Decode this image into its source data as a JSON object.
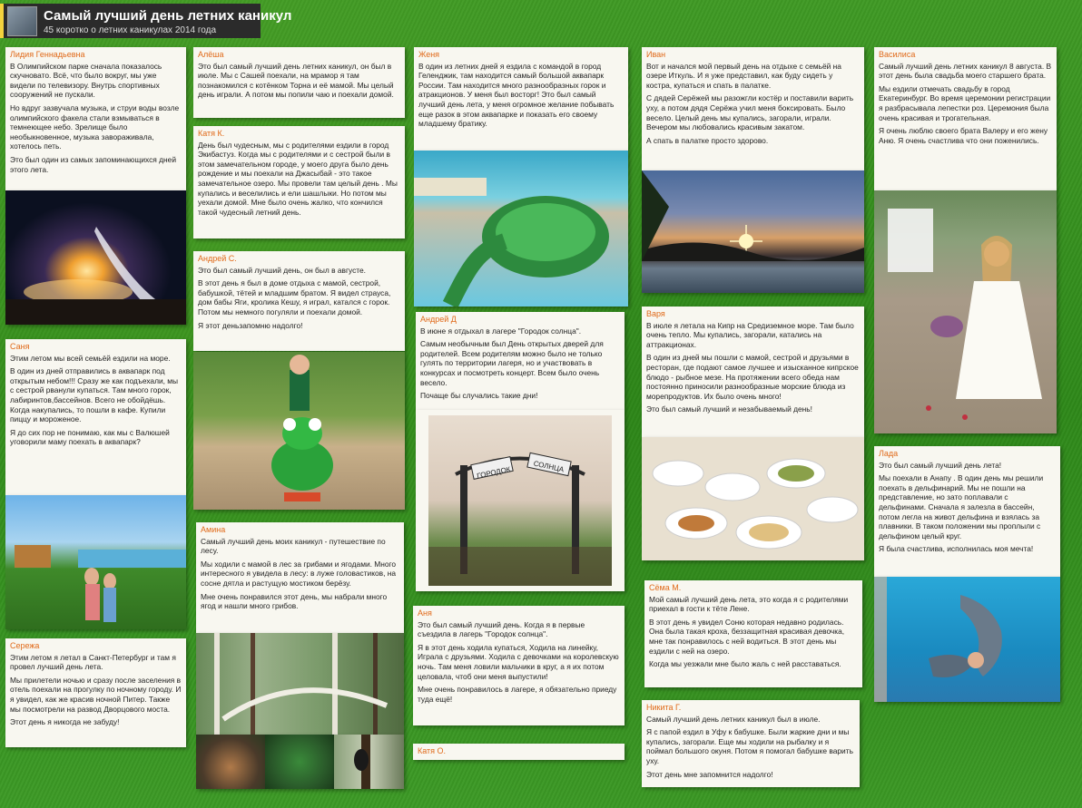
{
  "header": {
    "title": "Самый лучший день летних каникул",
    "subtitle": "45 коротко о летних каникулах 2014 года"
  },
  "notes": {
    "lidiya": {
      "author": "Лидия Геннадьевна",
      "p": [
        "В Олимпийском парке сначала показалось скучновато. Всё, что было вокруг, мы уже видели по телевизору. Внутрь спортивных сооружений не пускали.",
        "Но вдруг зазвучала музыка, и струи воды возле олимпийского факела стали взмываться в темнеющее небо. Зрелище было необыкновенное, музыка завораживала, хотелось петь.",
        "Это был один из самых запоминающихся дней этого лета."
      ]
    },
    "sanya": {
      "author": "Саня",
      "p": [
        "Этим летом мы всей семьёй ездили на море.",
        "В один из дней отправились в аквапарк под открытым небом!!! Сразу же как подъехали, мы с сестрой рванули купаться. Там много горок, лабиринтов,бассейнов. Всего не обойдёшь. Когда накупались, то пошли в кафе. Купили пиццу и мороженое.",
        "Я до сих пор не понимаю, как мы с Валюшей уговорили маму поехать в аквапарк?"
      ]
    },
    "serezha": {
      "author": "Сережа",
      "p": [
        "Этим летом я летал в Санкт-Петербург и там я провел лучший день лета.",
        "Мы прилетели ночью и сразу после заселения в отель поехали на прогулку по ночному городу. И я увидел, как же красив ночной Питер. Также мы посмотрели на развод Дворцового моста.",
        "Этот день я никогда не забуду!"
      ]
    },
    "alyosha": {
      "author": "Алёша",
      "p": [
        "Это был самый лучший день летних каникул, он был в июле. Мы с Сашей поехали, на мрамор я там познакомился с котёнком Торна и её мамой. Мы целый день играли. А потом мы попили чаю и поехали домой."
      ]
    },
    "katyak": {
      "author": "Катя К.",
      "p": [
        "День был чудесным, мы с родителями ездили в город Экибастуз. Когда мы с родителями и с сестрой были в этом замечательном городе, у моего друга было день рождение и мы поехали на Джасыбай - это такое замечательное озеро. Мы провели там целый день . Мы купались и веселились и ели шашлыки. Но потом мы уехали домой. Мне было очень жалко, что кончился такой чудесный летний день."
      ]
    },
    "andreys": {
      "author": "Андрей С.",
      "p": [
        "Это был самый лучший день, он был в августе.",
        "В этот день я был в доме отдыха с мамой, сестрой, бабушкой, тётей и младшим братом. Я видел страуса, дом бабы Яги, кролика Кешу, я играл, катался с горок. Потом мы немного погуляли и поехали домой.",
        "Я этот деньзапомню надолго!"
      ]
    },
    "amina": {
      "author": "Амина",
      "p": [
        "Самый лучший день моих каникул - путешествие по лесу.",
        "Мы ходили с мамой в лес за грибами и ягодами. Много интересного я увидела в лесу: в луже головастиков, на сосне дятла и растущую мостиком берёзу.",
        "Мне очень понравился этот день, мы набрали много ягод и нашли много грибов."
      ]
    },
    "zhenya": {
      "author": "Женя",
      "p": [
        "В один из летних дней я ездила с командой в город Геленджик, там находится самый большой аквапарк России. Там находится много разнообразных горок и атракционов. У меня был восторг! Это был самый лучший день лета, у меня огромное желание побывать еще разок в этом аквапарке и показать его своему младшему братику."
      ]
    },
    "andreyd": {
      "author": "Андрей Д",
      "p": [
        "В июне я отдыхал в лагере \"Городок солнца\".",
        "Самым необычным был День открытых дверей для родителей. Всем родителям можно было не только гулять по территории лагеря, но и участвовать в конкурсах и посмотреть концерт. Всем было очень весело.",
        "Почаще бы случались такие дни!"
      ]
    },
    "anya": {
      "author": "Аня",
      "p": [
        "Это был самый лучший день. Когда я в первые съездила в лагерь \"Городок солнца\".",
        "Я в этот день ходила купаться, Ходила на линейку, Играла с друзьями. Ходила с девочками на королевскую ночь. Там меня ловили мальчики в круг, а я их потом целовала, чтоб они меня выпустили!",
        "Мне очень понравилось в лагере, я обязательно приеду туда ещё!"
      ]
    },
    "katyao": {
      "author": "Катя О.",
      "p": []
    },
    "ivan": {
      "author": "Иван",
      "p": [
        "Вот и начался мой первый день на отдыхе с семьёй на озере Иткуль. И я уже представил, как буду сидеть у костра, купаться и спать в палатке.",
        "С дядей Серёжей мы разожгли костёр и поставили варить уху, а потом дядя Серёжа учил меня боксировать. Было весело. Целый день мы купались, загорали, играли. Вечером мы любовались красивым закатом.",
        "А спать в палатке просто здорово."
      ]
    },
    "varya": {
      "author": "Варя",
      "p": [
        "В июле я летала на Кипр на Средиземное море. Там было очень тепло. Мы купались, загорали, катались на аттракционах.",
        "В один из дней мы пошли с мамой, сестрой и друзьями в ресторан, где подают самое лучшее и изысканное кипрское блюдо - рыбное мезе. На протяжении всего обеда нам постоянно приносили разнообразные морские блюда из морепродуктов. Их было очень много!",
        "Это был самый лучший и незабываемый день!"
      ]
    },
    "syoma": {
      "author": "Сёма М.",
      "p": [
        "Мой самый лучший день лета, это когда я с родителями приехал в гости к тёте Лене.",
        "В этот день я увидел Соню которая недавно родилась. Она была такая кроха, беззащитная красивая девочка, мне так понравилось с ней водиться. В этот день мы ездили с ней на озеро.",
        "Когда мы уезжали мне было жаль с ней расставаться."
      ]
    },
    "nikita": {
      "author": "Никита Г.",
      "p": [
        "Самый лучший день летних каникул был в июле.",
        "Я с папой ездил в Уфу к бабушке. Были жаркие дни и мы купались, загорали. Еще мы ходили на рыбалку и я поймал большого окуня. Потом я помогал бабушке варить уху.",
        "Этот день мне запомнится надолго!"
      ]
    },
    "vasilisa": {
      "author": "Василиса",
      "p": [
        "Самый лучший день летних каникул 8 августа. В этот день была свадьба моего старшего брата.",
        "Мы ездили отмечать свадьбу в город Екатеринбург. Во время церемонии регистрации я разбрасывала лепестки роз. Церемония была очень красивая и трогательная.",
        "Я очень люблю своего брата Валеру и его жену Аню. Я очень счастлива что они поженились."
      ]
    },
    "lada": {
      "author": "Лада",
      "p": [
        "Это был самый лучший день лета!",
        "Мы поехали в Анапу . В один день мы решили поехать в дельфинарий. Мы не пошли на представление, но зато поплавали с дельфинами. Сначала я залезла в бассейн, потом легла на живот дельфина и взялась за плавники. В таком положении мы проплыли с дельфином целый круг.",
        "Я была счастлива, исполнилась моя мечта!"
      ]
    }
  },
  "photos": {
    "sign_text": "ГОРОДОК СОЛНЦА",
    "sign_left": "ГОРОДОК",
    "sign_right": "СОЛНЦА"
  }
}
